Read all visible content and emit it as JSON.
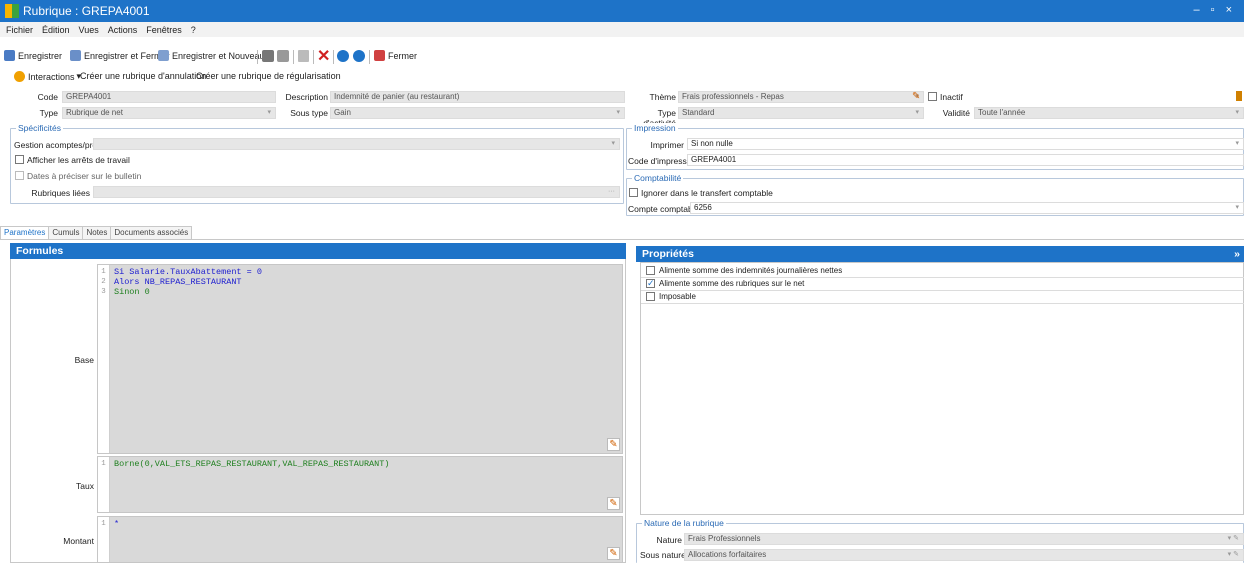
{
  "window": {
    "title": "Rubrique : GREPA4001",
    "controls": "– ▫ ×"
  },
  "menu": [
    "Fichier",
    "Édition",
    "Vues",
    "Actions",
    "Fenêtres",
    "?"
  ],
  "toolbar": {
    "save": "Enregistrer",
    "save_close": "Enregistrer et Fermer",
    "save_new": "Enregistrer et Nouveau",
    "close": "Fermer"
  },
  "actions": {
    "interactions": "Interactions",
    "cancel_entry": "Créer une rubrique d'annulation",
    "regul_entry": "Créer une rubrique de régularisation"
  },
  "header": {
    "code_label": "Code",
    "code_value": "GREPA4001",
    "type_label": "Type",
    "type_value": "Rubrique de net",
    "desc_label": "Description",
    "desc_value": "Indemnité de panier (au restaurant)",
    "subtype_label": "Sous type",
    "subtype_value": "Gain",
    "theme_label": "Thème",
    "theme_value": "Frais professionnels - Repas",
    "inactive_label": "Inactif",
    "activity_label": "Type d'activité",
    "activity_value": "Standard",
    "validity_label": "Validité",
    "validity_value": "Toute l'année"
  },
  "specificites": {
    "title": "Spécificités",
    "acomptes_label": "Gestion acomptes/prêts",
    "acomptes_value": "",
    "arrets_label": "Afficher les arrêts de travail",
    "dates_label": "Dates à préciser sur le bulletin",
    "liees_label": "Rubriques liées",
    "liees_btn": "···"
  },
  "impression": {
    "title": "Impression",
    "print_label": "Imprimer",
    "print_value": "Si non nulle",
    "code_label": "Code d'impression",
    "code_value": "GREPA4001"
  },
  "comptabilite": {
    "title": "Comptabilité",
    "ignore_label": "Ignorer dans le transfert comptable",
    "account_label": "Compte comptable",
    "account_value": "6256"
  },
  "tabs": [
    "Paramètres",
    "Cumuls",
    "Notes",
    "Documents associés"
  ],
  "formules": {
    "title": "Formules",
    "base_label": "Base",
    "base_lines": [
      "Si Salarie.TauxAbattement = 0",
      "Alors NB_REPAS_RESTAURANT",
      "Sinon 0"
    ],
    "taux_label": "Taux",
    "taux_lines": [
      "Borne(0,VAL_ETS_REPAS_RESTAURANT,VAL_REPAS_RESTAURANT)"
    ],
    "montant_label": "Montant",
    "montant_lines": [
      "*"
    ]
  },
  "proprietes": {
    "title": "Propriétés",
    "expand": "»",
    "items": [
      {
        "label": "Alimente somme des indemnités journalières nettes",
        "checked": false
      },
      {
        "label": "Alimente somme des rubriques sur le net",
        "checked": true
      },
      {
        "label": "Imposable",
        "checked": false
      }
    ]
  },
  "nature": {
    "title": "Nature de la rubrique",
    "nature_label": "Nature",
    "nature_value": "Frais Professionnels",
    "subnature_label": "Sous nature",
    "subnature_value": "Allocations forfaitaires"
  },
  "colors": {
    "accent": "#1e73c8",
    "delete": "#d02020",
    "field_bg": "#e6e6e6",
    "code_blue": "#2020d0",
    "code_green": "#208020"
  }
}
